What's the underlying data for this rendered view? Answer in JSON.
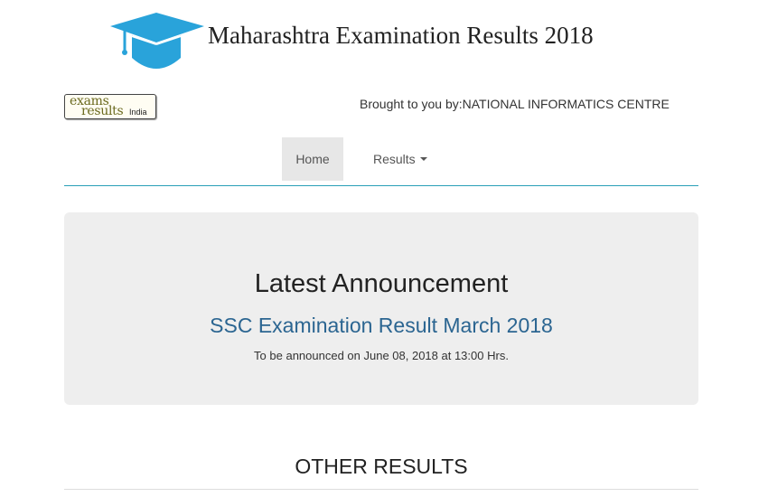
{
  "header": {
    "title": "Maharashtra Examination Results 2018",
    "brand_color": "#29a3da"
  },
  "logo": {
    "line1": "exams",
    "line2": "results",
    "suffix": "India"
  },
  "credit": "Brought to you by:NATIONAL INFORMATICS CENTRE",
  "nav": {
    "items": [
      {
        "label": "Home",
        "active": true
      },
      {
        "label": "Results",
        "dropdown": true
      }
    ],
    "underline_color": "#2a9fb8"
  },
  "announcement": {
    "heading": "Latest Announcement",
    "link": "SSC Examination Result March 2018",
    "note": "To be announced on June 08, 2018 at 13:00 Hrs.",
    "link_color": "#2b6591"
  },
  "other_results": {
    "heading": "OTHER RESULTS"
  }
}
